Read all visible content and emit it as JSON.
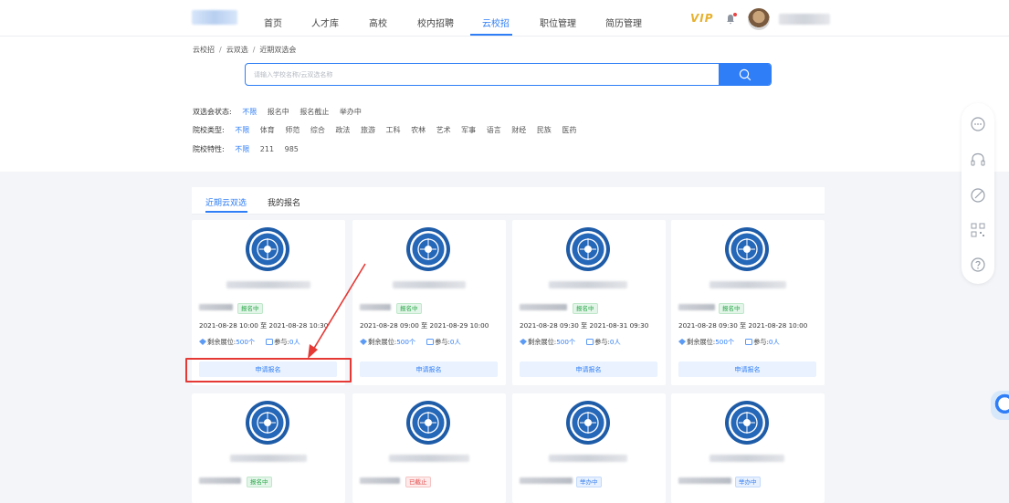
{
  "nav": {
    "items": [
      "首页",
      "人才库",
      "高校",
      "校内招聘",
      "云校招",
      "职位管理",
      "简历管理"
    ],
    "active_index": 4,
    "vip": "VIP"
  },
  "breadcrumb": [
    "云校招",
    "云双选",
    "近期双选会"
  ],
  "search": {
    "placeholder": "请输入学校名称/云双选名称"
  },
  "filters": [
    {
      "label": "双选会状态:",
      "options": [
        "不限",
        "报名中",
        "报名截止",
        "举办中"
      ],
      "selected": 0
    },
    {
      "label": "院校类型:",
      "options": [
        "不限",
        "体育",
        "师范",
        "综合",
        "政法",
        "旅游",
        "工科",
        "农林",
        "艺术",
        "军事",
        "语言",
        "财经",
        "民族",
        "医药"
      ],
      "selected": 0
    },
    {
      "label": "院校特性:",
      "options": [
        "不限",
        "211",
        "985"
      ],
      "selected": 0
    }
  ],
  "tabs": [
    "近期云双选",
    "我的报名"
  ],
  "cards": [
    {
      "status": "报名中",
      "status_color": "green",
      "date": "2021-08-28 10:00 至 2021-08-28 10:30",
      "remaining_label": "剩余展位:",
      "remaining": "500个",
      "participants_label": "参与:",
      "participants": "0人",
      "apply": "申请报名"
    },
    {
      "status": "报名中",
      "status_color": "green",
      "date": "2021-08-28 09:00 至 2021-08-29 10:00",
      "remaining_label": "剩余展位:",
      "remaining": "500个",
      "participants_label": "参与:",
      "participants": "0人",
      "apply": "申请报名"
    },
    {
      "status": "报名中",
      "status_color": "green",
      "date": "2021-08-28 09:30 至 2021-08-31 09:30",
      "remaining_label": "剩余展位:",
      "remaining": "500个",
      "participants_label": "参与:",
      "participants": "0人",
      "apply": "申请报名"
    },
    {
      "status": "报名中",
      "status_color": "green",
      "date": "2021-08-28 09:30 至 2021-08-28 10:00",
      "remaining_label": "剩余展位:",
      "remaining": "500个",
      "participants_label": "参与:",
      "participants": "0人",
      "apply": "申请报名"
    },
    {
      "status": "报名中",
      "status_color": "green"
    },
    {
      "status": "已截止",
      "status_color": "red"
    },
    {
      "status": "举办中",
      "status_color": "blue"
    },
    {
      "status": "举办中",
      "status_color": "blue"
    }
  ],
  "colors": {
    "accent": "#2f7ef7",
    "highlight": "#e53935"
  }
}
